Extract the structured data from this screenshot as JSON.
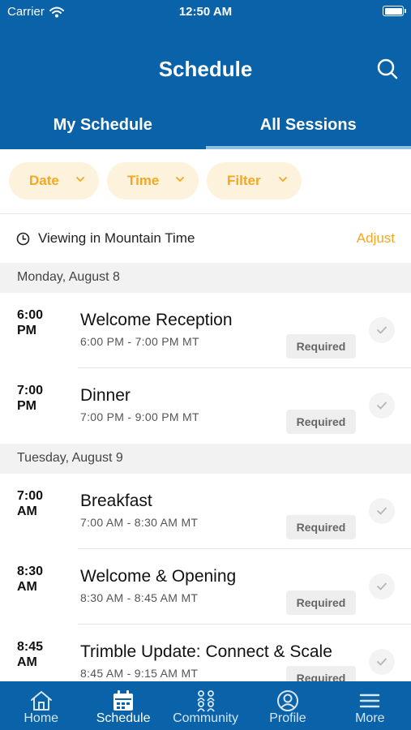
{
  "status_bar": {
    "carrier": "Carrier",
    "time": "12:50 AM"
  },
  "header": {
    "title": "Schedule"
  },
  "tabs": [
    {
      "label": "My Schedule",
      "active": false
    },
    {
      "label": "All Sessions",
      "active": true
    }
  ],
  "filters": [
    {
      "label": "Date"
    },
    {
      "label": "Time"
    },
    {
      "label": "Filter"
    }
  ],
  "timezone": {
    "text": "Viewing in Mountain Time",
    "action": "Adjust"
  },
  "days": [
    {
      "header": "Monday, August 8",
      "sessions": [
        {
          "time": "6:00 PM",
          "name": "Welcome Reception",
          "range": "6:00 PM - 7:00 PM MT",
          "badge": "Required"
        },
        {
          "time": "7:00 PM",
          "name": "Dinner",
          "range": "7:00 PM - 9:00 PM MT",
          "badge": "Required"
        }
      ]
    },
    {
      "header": "Tuesday, August 9",
      "sessions": [
        {
          "time": "7:00 AM",
          "name": "Breakfast",
          "range": "7:00 AM - 8:30 AM MT",
          "badge": "Required"
        },
        {
          "time": "8:30 AM",
          "name": "Welcome & Opening",
          "range": "8:30 AM - 8:45 AM MT",
          "badge": "Required"
        },
        {
          "time": "8:45 AM",
          "name": "Trimble Update: Connect & Scale",
          "range": "8:45 AM - 9:15 AM MT",
          "badge": "Required"
        }
      ]
    }
  ],
  "tab_bar": [
    {
      "label": "Home",
      "icon": "home-icon",
      "active": false
    },
    {
      "label": "Schedule",
      "icon": "calendar-icon",
      "active": true
    },
    {
      "label": "Community",
      "icon": "community-icon",
      "active": false
    },
    {
      "label": "Profile",
      "icon": "profile-icon",
      "active": false
    },
    {
      "label": "More",
      "icon": "menu-icon",
      "active": false
    }
  ],
  "colors": {
    "primary": "#0a62a8",
    "accent": "#f5a623",
    "chip_bg": "#fdf3dc",
    "tab_indicator": "#8ebfe0"
  }
}
